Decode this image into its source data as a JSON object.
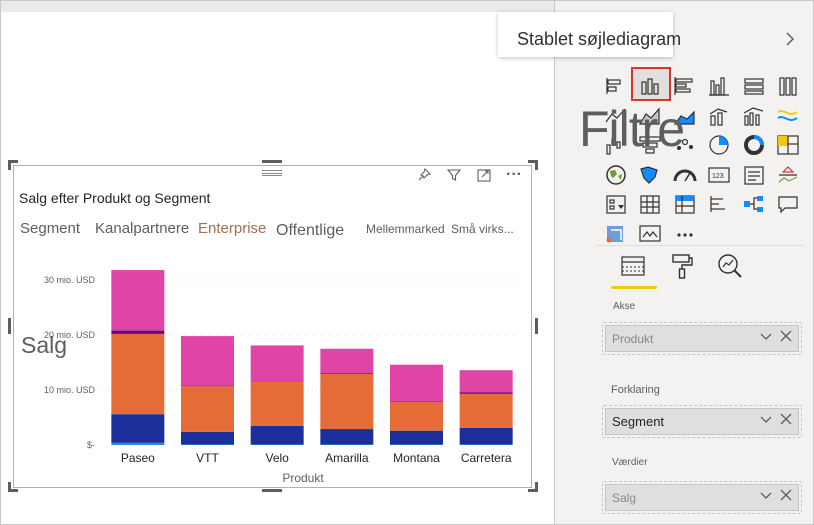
{
  "tooltip": {
    "text": "Stablet søjlediagram"
  },
  "overlay": {
    "filters_text": "Filtre",
    "salg_text": "Salg"
  },
  "visual": {
    "title": "Salg efter Produkt og Segment",
    "header_icons": [
      "pin-icon",
      "filter-icon",
      "focus-mode-icon",
      "more-options-icon"
    ]
  },
  "legend": {
    "title": "Segment",
    "items": [
      "Kanalpartnere",
      "Enterprise",
      "Offentlige",
      "Mellemmarked",
      "Små virks..."
    ]
  },
  "chart_data": {
    "type": "bar",
    "stacked": true,
    "categories": [
      "Paseo",
      "VTT",
      "Velo",
      "Amarilla",
      "Montana",
      "Carretera"
    ],
    "series": [
      {
        "name": "Kanalpartnere",
        "color": "#1a8fe3",
        "values": [
          0.4,
          0.1,
          0.1,
          0.1,
          0.1,
          0.1
        ]
      },
      {
        "name": "Enterprise",
        "color": "#1c2e99",
        "values": [
          5.2,
          2.3,
          3.4,
          2.8,
          2.5,
          3.0
        ]
      },
      {
        "name": "Offentlige",
        "color": "#e66c37",
        "values": [
          14.6,
          8.3,
          8.0,
          10.0,
          5.2,
          6.2
        ]
      },
      {
        "name": "Mellemmarked",
        "color": "#6b007b",
        "values": [
          0.6,
          0.1,
          0.1,
          0.1,
          0.1,
          0.3
        ]
      },
      {
        "name": "Små virks...",
        "color": "#e044a7",
        "values": [
          11.0,
          9.0,
          6.5,
          4.5,
          6.7,
          4.0
        ]
      }
    ],
    "xlabel": "Produkt",
    "ylabel": "",
    "yticks": [
      "$-",
      "10 mio. USD",
      "20 mio. USD",
      "30 mio. USD"
    ],
    "ytick_values": [
      0,
      10,
      20,
      30
    ],
    "ylim": [
      0,
      34
    ]
  },
  "pane": {
    "gallery_icons": [
      "stacked-bar-chart-icon",
      "stacked-column-chart-icon",
      "clustered-bar-chart-icon",
      "clustered-column-chart-icon",
      "100-stacked-bar-chart-icon",
      "100-stacked-column-chart-icon",
      "line-chart-icon",
      "area-chart-icon",
      "stacked-area-chart-icon",
      "line-column-chart-icon",
      "line-clustered-column-chart-icon",
      "ribbon-chart-icon",
      "waterfall-chart-icon",
      "funnel-chart-icon",
      "scatter-chart-icon",
      "pie-chart-icon",
      "donut-chart-icon",
      "treemap-icon",
      "map-icon",
      "filled-map-icon",
      "gauge-icon",
      "card-icon",
      "multi-row-card-icon",
      "kpi-icon",
      "slicer-icon",
      "table-icon",
      "matrix-icon",
      "key-influencers-icon",
      "decomposition-tree-icon",
      "qa-icon",
      "python-visual-icon",
      "paginated-report-icon",
      "more-visuals-icon"
    ],
    "tabs": [
      "fields-tab-icon",
      "format-tab-icon",
      "analytics-tab-icon"
    ],
    "wells": [
      {
        "label": "Akse",
        "value": "Produkt",
        "active": false
      },
      {
        "label": "Forklaring",
        "value": "Segment",
        "active": true
      },
      {
        "label": "Værdier",
        "value": "Salg",
        "active": false
      }
    ],
    "more_glyph": "···"
  }
}
